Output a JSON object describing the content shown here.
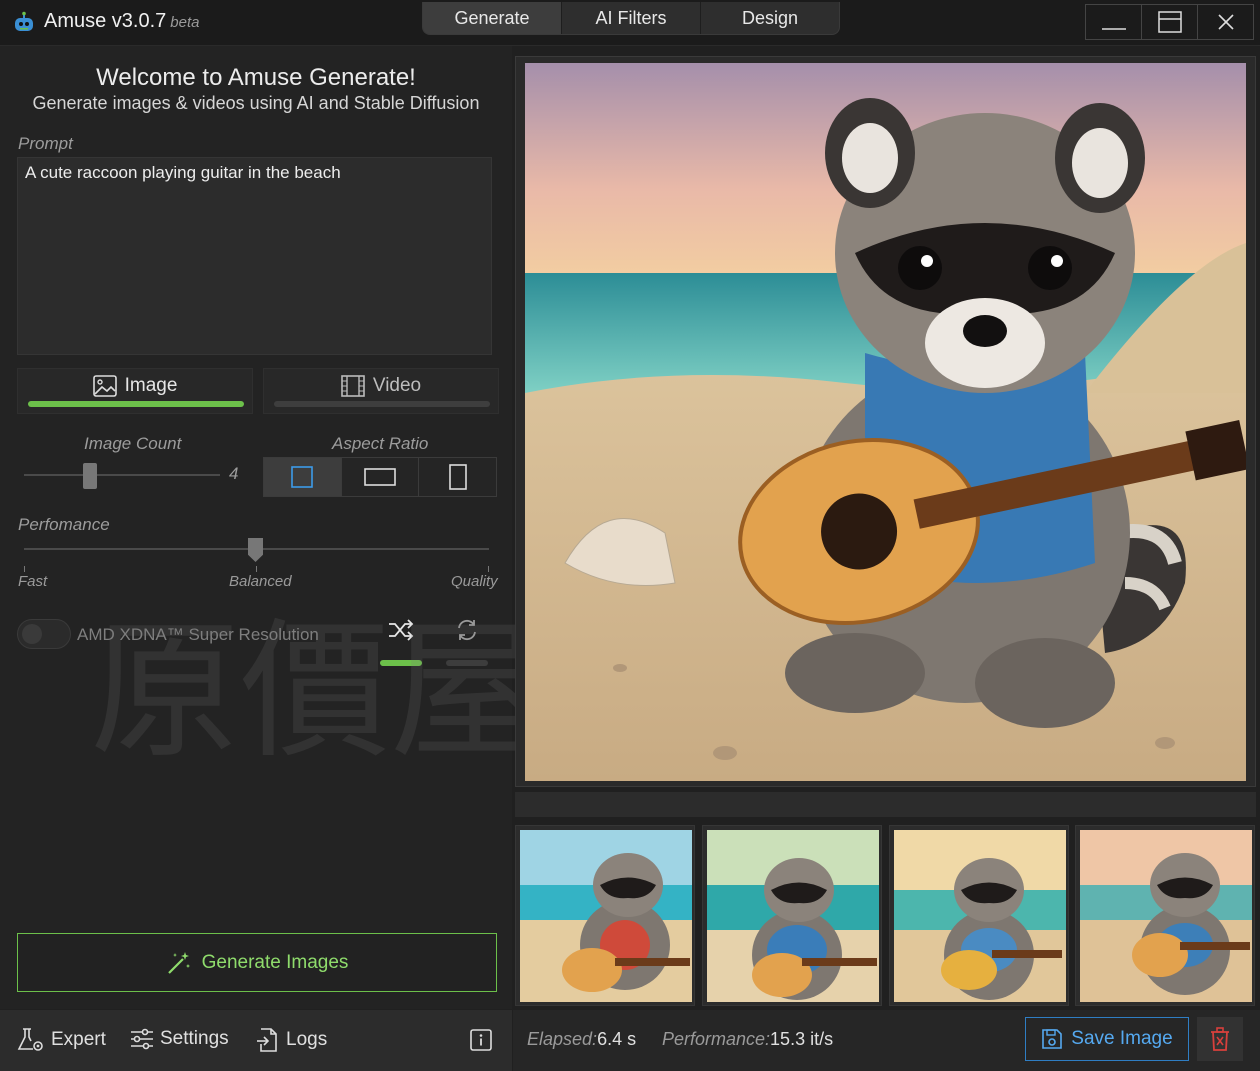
{
  "app": {
    "title": "Amuse v3.0.7",
    "badge": "beta"
  },
  "top_tabs": [
    {
      "label": "Generate",
      "active": true
    },
    {
      "label": "AI Filters",
      "active": false
    },
    {
      "label": "Design",
      "active": false
    }
  ],
  "window_controls": [
    "minimize-icon",
    "maximize-icon",
    "close-icon"
  ],
  "welcome": {
    "title": "Welcome to Amuse Generate!",
    "subtitle": "Generate images & videos using AI and Stable Diffusion"
  },
  "prompt": {
    "label": "Prompt",
    "value": "A cute raccoon playing guitar in the beach"
  },
  "mode_tabs": [
    {
      "label": "Image",
      "icon": "image-icon",
      "active": true
    },
    {
      "label": "Video",
      "icon": "film-icon",
      "active": false
    }
  ],
  "image_count": {
    "label": "Image Count",
    "value": "4"
  },
  "aspect_ratio": {
    "label": "Aspect Ratio",
    "options": [
      "square",
      "landscape",
      "portrait"
    ],
    "selected": "square"
  },
  "performance": {
    "label": "Perfomance",
    "ticks": [
      "Fast",
      "Balanced",
      "Quality"
    ],
    "selected": "Balanced"
  },
  "super_resolution": {
    "label": "AMD XDNA™ Super Resolution",
    "enabled": false
  },
  "seed_modes": [
    {
      "icon": "shuffle-icon",
      "active": true
    },
    {
      "icon": "refresh-icon",
      "active": false
    }
  ],
  "generate_button": {
    "label": "Generate Images",
    "icon": "magic-wand-icon"
  },
  "bottom_nav": [
    {
      "label": "Expert",
      "icon": "flask-gear-icon"
    },
    {
      "label": "Settings",
      "icon": "sliders-icon"
    },
    {
      "label": "Logs",
      "icon": "log-export-icon"
    }
  ],
  "stats": {
    "elapsed_label": "Elapsed:",
    "elapsed_value": "6.4 s",
    "performance_label": "Performance:",
    "performance_value": "15.3 it/s"
  },
  "save_button": {
    "label": "Save Image",
    "icon": "save-icon"
  },
  "colors": {
    "accent_green": "#6cc04a",
    "accent_blue": "#2f7ec4",
    "delete_red": "#d8403c"
  },
  "watermark": {
    "text": "原價屋coolpc"
  }
}
